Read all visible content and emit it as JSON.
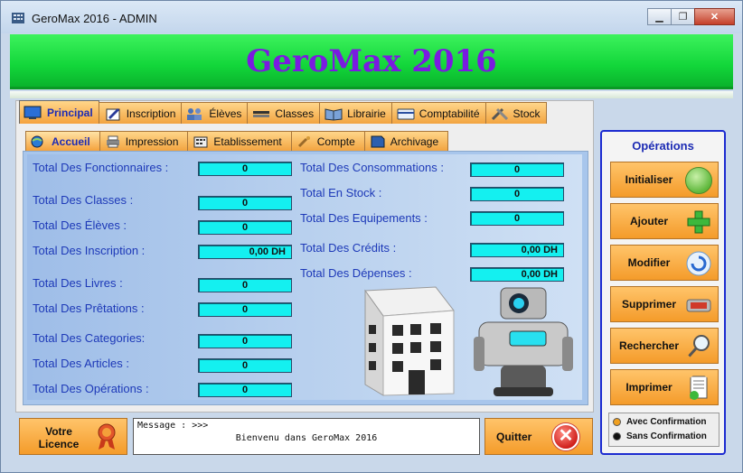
{
  "window": {
    "title": "GeroMax 2016  -  ADMIN",
    "minimize": "▁",
    "maximize": "❐",
    "close": "✕"
  },
  "banner": {
    "title": "GeroMax 2016"
  },
  "tabs": [
    {
      "label": "Principal",
      "icon": "monitor-icon"
    },
    {
      "label": "Inscription",
      "icon": "pen-icon"
    },
    {
      "label": "Élèves",
      "icon": "users-icon"
    },
    {
      "label": "Classes",
      "icon": "pencils-icon"
    },
    {
      "label": "Librairie",
      "icon": "book-icon"
    },
    {
      "label": "Comptabilité",
      "icon": "card-icon"
    },
    {
      "label": "Stock",
      "icon": "tools-icon"
    }
  ],
  "subtabs": [
    {
      "label": "Accueil",
      "icon": "globe-icon"
    },
    {
      "label": "Impression",
      "icon": "printer-icon"
    },
    {
      "label": "Etablissement",
      "icon": "grid-icon"
    },
    {
      "label": "Compte",
      "icon": "key-icon"
    },
    {
      "label": "Archivage",
      "icon": "sd-card-icon"
    }
  ],
  "stats_left": [
    {
      "label": "Total Des Fonctionnaires :",
      "value": "0"
    },
    {
      "label": "Total Des Classes :",
      "value": "0"
    },
    {
      "label": "Total Des Élèves   :",
      "value": "0"
    },
    {
      "label": "Total Des Inscription :",
      "value": "0,00 DH"
    },
    {
      "label": "Total Des Livres  :",
      "value": "0"
    },
    {
      "label": "Total Des Prêtations  :",
      "value": "0"
    },
    {
      "label": "Total Des Categories:",
      "value": "0"
    },
    {
      "label": "Total Des Articles  :",
      "value": "0"
    },
    {
      "label": "Total Des Opérations  :",
      "value": "0"
    }
  ],
  "stats_right": [
    {
      "label": "Total Des Consommations  :",
      "value": "0"
    },
    {
      "label": "Total En Stock  :",
      "value": "0"
    },
    {
      "label": "Total Des Equipements  :",
      "value": "0"
    },
    {
      "label": "Total Des Crédits  :",
      "value": "0,00 DH"
    },
    {
      "label": "Total Des Dépenses  :",
      "value": "0,00 DH"
    }
  ],
  "operations": {
    "title": "Opérations",
    "buttons": [
      {
        "label": "Initialiser",
        "icon": "arrow-icon"
      },
      {
        "label": "Ajouter",
        "icon": "plus-icon"
      },
      {
        "label": "Modifier",
        "icon": "refresh-icon"
      },
      {
        "label": "Supprimer",
        "icon": "delete-icon"
      },
      {
        "label": "Rechercher",
        "icon": "magnifier-icon"
      },
      {
        "label": "Imprimer",
        "icon": "document-check-icon"
      }
    ],
    "confirm_on": "Avec Confirmation",
    "confirm_off": "Sans Confirmation"
  },
  "licence_label": "Votre Licence",
  "message": {
    "prefix": "Message : >>>",
    "text": "Bienvenu dans GeroMax 2016"
  },
  "quit": {
    "label": "Quitter",
    "symbol": "✕"
  }
}
